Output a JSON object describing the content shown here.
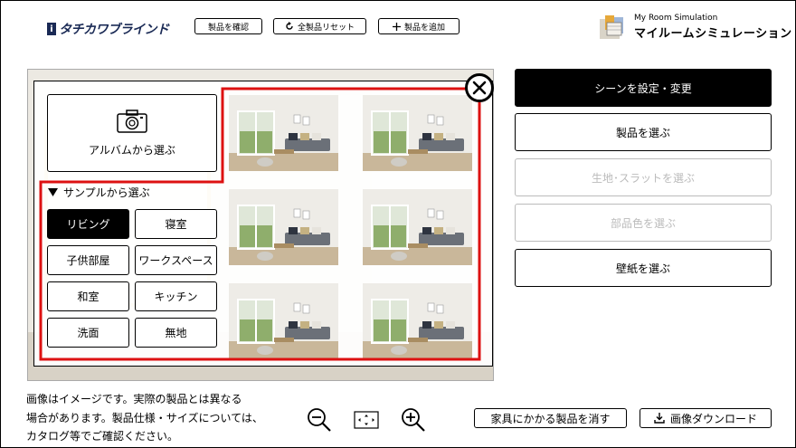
{
  "brand": {
    "mark": "i",
    "name": "タチカワブラインド"
  },
  "toolbar": {
    "check_products": "製品を確認",
    "reset_all": "全製品リセット",
    "add_product": "製品を追加"
  },
  "app": {
    "subtitle": "My Room Simulation",
    "title": "マイルームシミュレーション"
  },
  "scene_picker": {
    "album_label": "アルバムから選ぶ",
    "sample_label": "サンプルから選ぶ",
    "categories": [
      "リビング",
      "寝室",
      "子供部屋",
      "ワークスペース",
      "和室",
      "キッチン",
      "洗面",
      "無地"
    ],
    "active_category": "リビング",
    "thumbnails": [
      "living-1",
      "living-2",
      "living-3",
      "living-4",
      "living-5",
      "living-6"
    ]
  },
  "menu": {
    "items": [
      {
        "label": "シーンを設定・変更",
        "state": "active"
      },
      {
        "label": "製品を選ぶ",
        "state": "enabled"
      },
      {
        "label": "生地･スラットを選ぶ",
        "state": "disabled"
      },
      {
        "label": "部品色を選ぶ",
        "state": "disabled"
      },
      {
        "label": "壁紙を選ぶ",
        "state": "enabled"
      }
    ]
  },
  "footer": {
    "note_lines": [
      "画像はイメージです。実際の製品とは異なる",
      "場合があります。製品仕様・サイズについては、",
      "カタログ等でご確認ください。"
    ],
    "remove_furniture_products": "家具にかかる製品を消す",
    "download_image": "画像ダウンロード"
  },
  "colors": {
    "highlight": "#dd1111",
    "brand": "#1a2a55",
    "disabled": "#bbbbbb"
  },
  "icons": [
    "camera-icon",
    "triangle-down-icon",
    "close-icon",
    "rotate-icon",
    "plus-icon",
    "zoom-out-icon",
    "fit-icon",
    "zoom-in-icon",
    "download-icon",
    "app-logo-icon"
  ]
}
